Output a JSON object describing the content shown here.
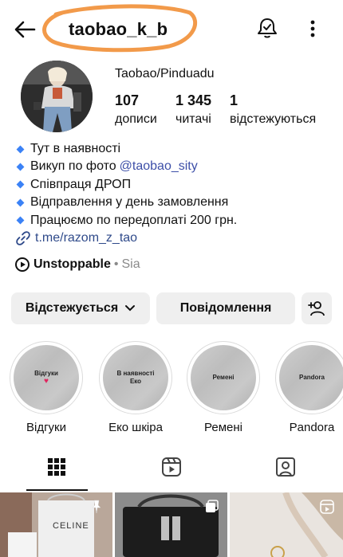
{
  "header": {
    "username": "taobao_k_b",
    "back_icon": "arrow-left-icon",
    "bell_icon": "bell-check-icon",
    "more_icon": "more-vertical-icon",
    "annotation_color": "#f29a4a"
  },
  "profile": {
    "display_name": "Taobao/Pinduadu",
    "stats": [
      {
        "value": "107",
        "label": "дописи"
      },
      {
        "value": "1 345",
        "label": "читачі"
      },
      {
        "value": "1",
        "label": "відстежуються"
      }
    ]
  },
  "bio": {
    "lines": [
      {
        "text": "Тут в наявності"
      },
      {
        "text": "Викуп по фото",
        "mention": "@taobao_sity"
      },
      {
        "text": "Співпраця ДРОП"
      },
      {
        "text": "Відправлення у день замовлення"
      },
      {
        "text": "Працюємо по передоплаті 200 грн."
      }
    ],
    "link": "t.me/razom_z_tao",
    "bullet_color": "#3b82f6"
  },
  "music": {
    "title": "Unstoppable",
    "separator": "•",
    "artist": "Sia"
  },
  "actions": {
    "follow_label": "Відстежується",
    "message_label": "Повідомлення",
    "add_person_icon": "person-add-icon"
  },
  "highlights": [
    {
      "cover_text_1": "Відгуки",
      "cover_text_2": "",
      "label": "Відгуки"
    },
    {
      "cover_text_1": "В наявності",
      "cover_text_2": "Еко",
      "label": "Еко шкіра"
    },
    {
      "cover_text_1": "Ремені",
      "cover_text_2": "",
      "label": "Ремені"
    },
    {
      "cover_text_1": "Pandora",
      "cover_text_2": "",
      "label": "Pandora"
    }
  ],
  "tabs": [
    {
      "name": "grid",
      "icon": "grid-icon",
      "active": true
    },
    {
      "name": "reels",
      "icon": "reels-icon",
      "active": false
    },
    {
      "name": "tagged",
      "icon": "tagged-icon",
      "active": false
    }
  ],
  "posts": [
    {
      "icon": "pin-icon",
      "caption": "CELINE"
    },
    {
      "icon": "carousel-icon",
      "caption": ""
    },
    {
      "icon": "reel-icon",
      "caption": ""
    }
  ]
}
